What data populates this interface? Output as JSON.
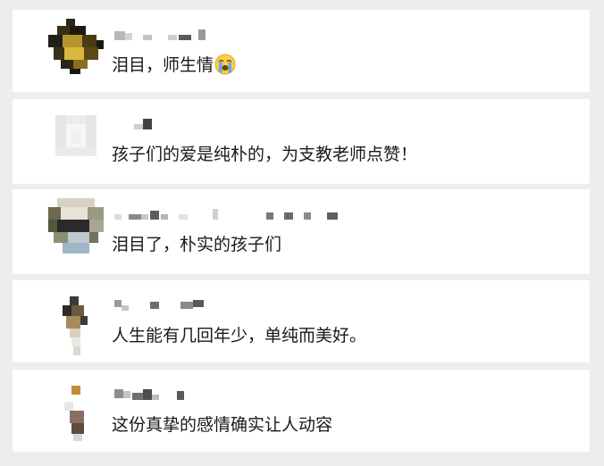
{
  "comments": [
    {
      "text": "泪目，师生情",
      "emoji": "loudly-crying-face"
    },
    {
      "text": "孩子们的爱是纯朴的，为支教老师点赞！"
    },
    {
      "text": "泪目了，朴实的孩子们"
    },
    {
      "text": "人生能有几回年少，单纯而美好。"
    },
    {
      "text": "这份真挚的感情确实让人动容"
    }
  ]
}
